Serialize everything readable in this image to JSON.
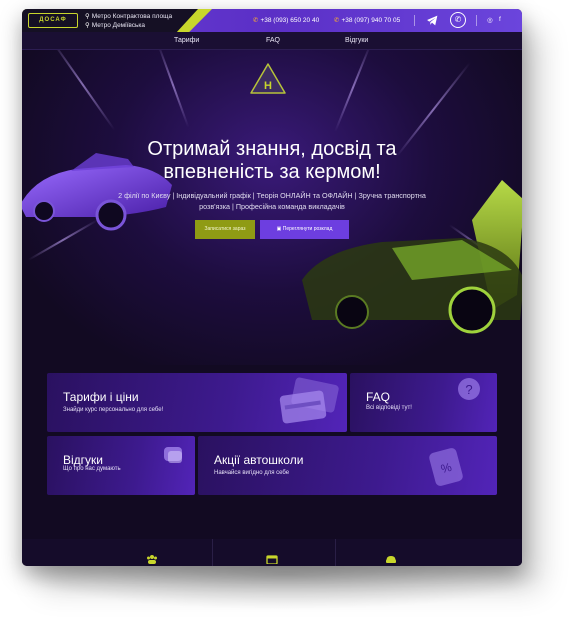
{
  "topbar": {
    "logo_text": "ДОСАФ",
    "address_1": "Метро Контрактова площа",
    "address_2": "Метро Деміївська",
    "phone_1": "+38 (093) 650 20 40",
    "phone_2": "+38 (097) 940 70 05",
    "social_instagram": "◎",
    "social_facebook": "f"
  },
  "nav": {
    "items": [
      "Тарифи",
      "FAQ",
      "Відгуки"
    ]
  },
  "hero": {
    "badge_letter": "Н",
    "title_line_1": "Отримай знання, досвід та",
    "title_line_2": "впевненість за кермом!",
    "subtitle": "2 філії по Києву | Індивідуальний графік | Теорія ОНЛАЙН та ОФЛАЙН | Зручна транспортна розв'язка | Професійна команда викладачів",
    "signup_button": "Записатися зараз",
    "schedule_button": "Переглянути розклад"
  },
  "cards": [
    {
      "title": "Тарифи і ціни",
      "subtitle": "Знайди курс персонально для себе!"
    },
    {
      "title": "FAQ",
      "subtitle": "Всі відповіді тут!"
    },
    {
      "title": "Відгуки",
      "subtitle": "Що про нас думають"
    },
    {
      "title": "Акції автошколи",
      "subtitle": "Навчайся вигідно для себе"
    }
  ],
  "colors": {
    "accent_lime": "#c8d62c",
    "accent_purple": "#6d3ee0",
    "background": "#120a22"
  }
}
